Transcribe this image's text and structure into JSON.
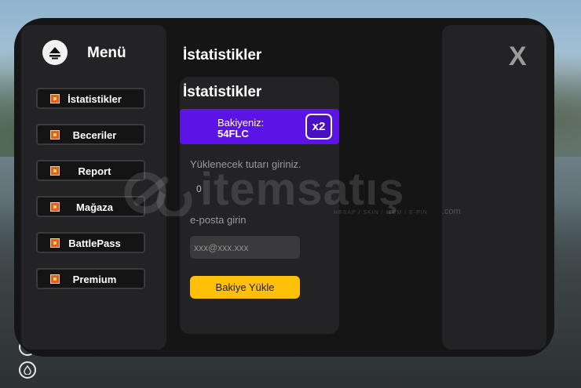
{
  "sidebar": {
    "title": "Menü",
    "items": [
      {
        "label": "İstatistikler"
      },
      {
        "label": "Beceriler"
      },
      {
        "label": "Report"
      },
      {
        "label": "Mağaza"
      },
      {
        "label": "BattlePass"
      },
      {
        "label": "Premium"
      }
    ]
  },
  "close": {
    "label": "X"
  },
  "main": {
    "page_title": "İstatistikler",
    "card_title": "İstatistikler",
    "balance": {
      "label": "Bakiyeniz:",
      "value": "54FLC",
      "multiplier": "x2"
    },
    "amount": {
      "label": "Yüklenecek tutarı giriniz.",
      "value": "0"
    },
    "email": {
      "label": "e-posta girin",
      "placeholder": "xxx@xxx.xxx"
    },
    "submit_label": "Bakiye Yükle"
  },
  "watermark": {
    "text": "itemsatış",
    "sub": "HESAP / SKIN / ITEM / E-PIN",
    "suffix": ".com"
  },
  "colors": {
    "accent": "#5b13e6",
    "button": "#ffc107",
    "panel": "#151516",
    "surface": "#232325"
  }
}
